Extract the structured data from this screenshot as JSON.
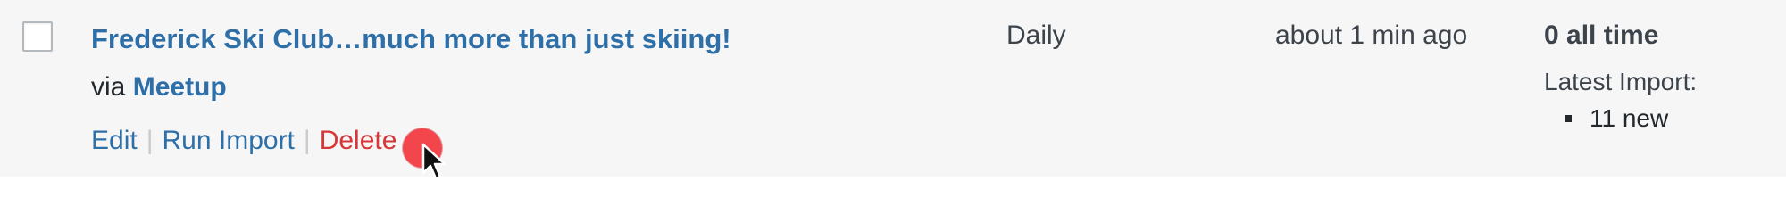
{
  "import_row": {
    "title": "Frederick Ski Club…much more than just skiing!",
    "via_prefix": "via",
    "source": "Meetup",
    "actions": {
      "edit": "Edit",
      "run_import": "Run Import",
      "delete": "Delete",
      "separator": "|"
    },
    "frequency": "Daily",
    "last_run": "about 1 min ago",
    "stats": {
      "total": "0 all time",
      "latest_label": "Latest Import:",
      "latest_items": [
        "11 new"
      ]
    }
  },
  "colors": {
    "link": "#2f6fa8",
    "delete": "#d63638",
    "row_background": "#f6f6f6",
    "click_marker": "#f2464c"
  },
  "icons": {
    "cursor": "mouse-pointer-icon",
    "click": "click-indicator-icon"
  }
}
